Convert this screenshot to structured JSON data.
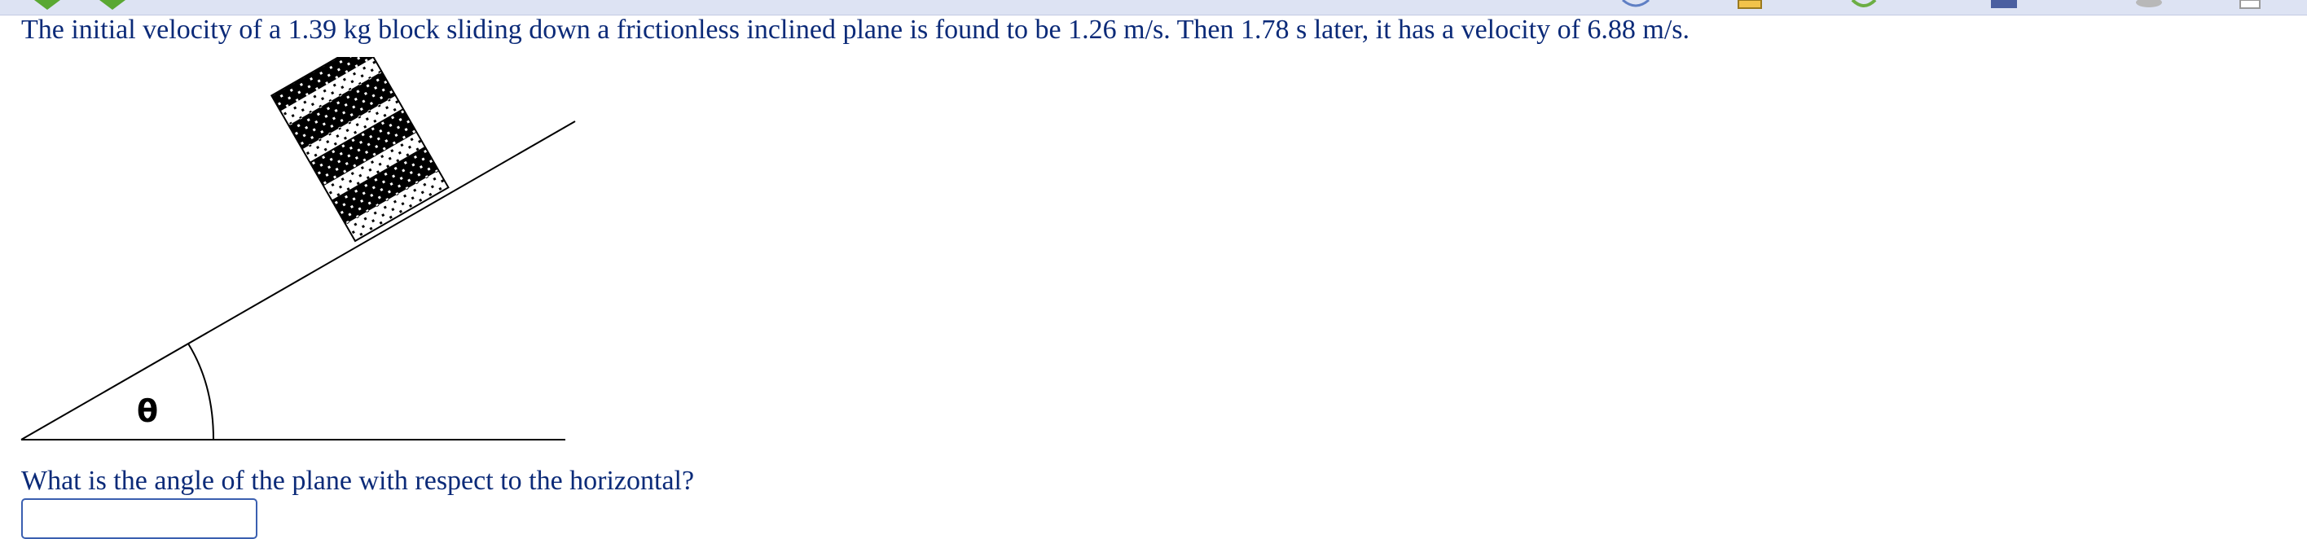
{
  "problem": {
    "statement": "The initial velocity of a 1.39 kg block sliding down a frictionless inclined plane is found to be 1.26 m/s. Then 1.78 s later, it has a velocity of 6.88 m/s.",
    "question": "What is the angle of the plane with respect to the horizontal?"
  },
  "figure": {
    "angle_label": "θ"
  },
  "answer": {
    "value": "",
    "placeholder": ""
  },
  "toolbar": {
    "icons": [
      "back-arrow-icon",
      "forward-arrow-icon",
      "help-icon",
      "note-icon",
      "refresh-icon",
      "printer-icon",
      "disk-icon",
      "page-icon"
    ]
  },
  "colors": {
    "text": "#0b2a78",
    "input_border": "#3a5fb0",
    "toolbar_bg": "#dde3f3"
  }
}
